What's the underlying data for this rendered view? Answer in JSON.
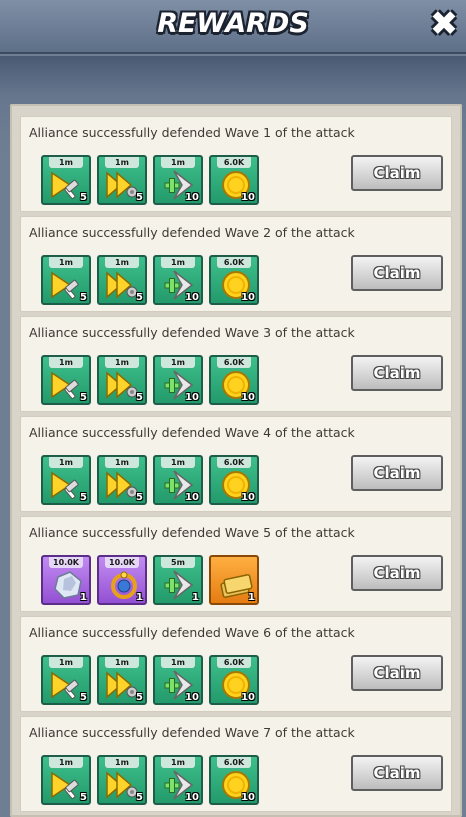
{
  "header": {
    "title": "REWARDS",
    "close_label": "✖"
  },
  "colors": {
    "card": "#f5f2ea",
    "panel": "#d9d4c9",
    "item_green": "#2fae7c",
    "item_purple": "#a660e0",
    "item_orange": "#f08e20"
  },
  "rows": [
    {
      "description": "Alliance successfully defended Wave 1 of the attack",
      "claim_label": "Claim",
      "items": [
        {
          "icon": "hammer-speedup-icon",
          "color": "green",
          "tag": "1m",
          "qty": "5"
        },
        {
          "icon": "wrench-speedup-icon",
          "color": "green",
          "tag": "1m",
          "qty": "5"
        },
        {
          "icon": "heal-speedup-icon",
          "color": "green",
          "tag": "1m",
          "qty": "10"
        },
        {
          "icon": "gold-coin-icon",
          "color": "green",
          "tag": "6.0K",
          "qty": "10"
        }
      ]
    },
    {
      "description": "Alliance successfully defended Wave 2 of the attack",
      "claim_label": "Claim",
      "items": [
        {
          "icon": "hammer-speedup-icon",
          "color": "green",
          "tag": "1m",
          "qty": "5"
        },
        {
          "icon": "wrench-speedup-icon",
          "color": "green",
          "tag": "1m",
          "qty": "5"
        },
        {
          "icon": "heal-speedup-icon",
          "color": "green",
          "tag": "1m",
          "qty": "10"
        },
        {
          "icon": "gold-coin-icon",
          "color": "green",
          "tag": "6.0K",
          "qty": "10"
        }
      ]
    },
    {
      "description": "Alliance successfully defended Wave 3 of the attack",
      "claim_label": "Claim",
      "items": [
        {
          "icon": "hammer-speedup-icon",
          "color": "green",
          "tag": "1m",
          "qty": "5"
        },
        {
          "icon": "wrench-speedup-icon",
          "color": "green",
          "tag": "1m",
          "qty": "5"
        },
        {
          "icon": "heal-speedup-icon",
          "color": "green",
          "tag": "1m",
          "qty": "10"
        },
        {
          "icon": "gold-coin-icon",
          "color": "green",
          "tag": "6.0K",
          "qty": "10"
        }
      ]
    },
    {
      "description": "Alliance successfully defended Wave 4 of the attack",
      "claim_label": "Claim",
      "items": [
        {
          "icon": "hammer-speedup-icon",
          "color": "green",
          "tag": "1m",
          "qty": "5"
        },
        {
          "icon": "wrench-speedup-icon",
          "color": "green",
          "tag": "1m",
          "qty": "5"
        },
        {
          "icon": "heal-speedup-icon",
          "color": "green",
          "tag": "1m",
          "qty": "10"
        },
        {
          "icon": "gold-coin-icon",
          "color": "green",
          "tag": "6.0K",
          "qty": "10"
        }
      ]
    },
    {
      "description": "Alliance successfully defended Wave 5 of the attack",
      "claim_label": "Claim",
      "items": [
        {
          "icon": "crystal-ore-icon",
          "color": "purple",
          "tag": "10.0K",
          "qty": "1"
        },
        {
          "icon": "ring-artifact-icon",
          "color": "purple",
          "tag": "10.0K",
          "qty": "1"
        },
        {
          "icon": "heal-speedup-icon",
          "color": "green",
          "tag": "5m",
          "qty": "1"
        },
        {
          "icon": "envelope-tickets-icon",
          "color": "orange",
          "tag": "",
          "qty": "1"
        }
      ]
    },
    {
      "description": "Alliance successfully defended Wave 6 of the attack",
      "claim_label": "Claim",
      "items": [
        {
          "icon": "hammer-speedup-icon",
          "color": "green",
          "tag": "1m",
          "qty": "5"
        },
        {
          "icon": "wrench-speedup-icon",
          "color": "green",
          "tag": "1m",
          "qty": "5"
        },
        {
          "icon": "heal-speedup-icon",
          "color": "green",
          "tag": "1m",
          "qty": "10"
        },
        {
          "icon": "gold-coin-icon",
          "color": "green",
          "tag": "6.0K",
          "qty": "10"
        }
      ]
    },
    {
      "description": "Alliance successfully defended Wave 7 of the attack",
      "claim_label": "Claim",
      "items": [
        {
          "icon": "hammer-speedup-icon",
          "color": "green",
          "tag": "1m",
          "qty": "5"
        },
        {
          "icon": "wrench-speedup-icon",
          "color": "green",
          "tag": "1m",
          "qty": "5"
        },
        {
          "icon": "heal-speedup-icon",
          "color": "green",
          "tag": "1m",
          "qty": "10"
        },
        {
          "icon": "gold-coin-icon",
          "color": "green",
          "tag": "6.0K",
          "qty": "10"
        }
      ]
    }
  ]
}
